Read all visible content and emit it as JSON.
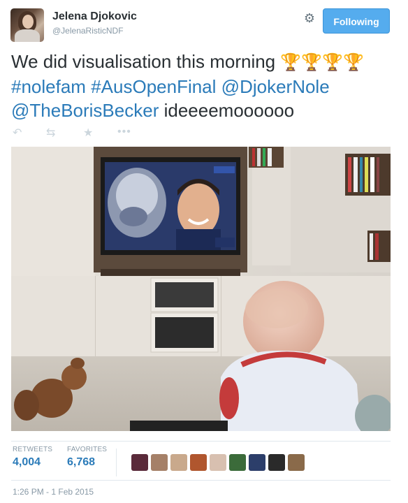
{
  "user": {
    "name": "Jelena Djokovic",
    "handle": "@JelenaRisticNDF",
    "follow_label": "Following"
  },
  "tweet": {
    "text_lead": "We did visualisation this morning",
    "trophy_glyph": "🏆",
    "hashtag1": "#nolefam",
    "hashtag2": "#AusOpenFinal",
    "mention1": "@DjokerNole",
    "mention2": "@TheBorisBecker",
    "text_tail": "ideeeemoooooo"
  },
  "actions": {
    "reply_icon": "reply-icon",
    "retweet_icon": "retweet-icon",
    "favorite_icon": "star-icon",
    "more_icon": "more-icon"
  },
  "stats": {
    "retweets_label": "RETWEETS",
    "retweets_value": "4,004",
    "favorites_label": "FAVORITES",
    "favorites_value": "6,768"
  },
  "timestamp": "1:26 PM - 1 Feb 2015",
  "colors": {
    "link": "#2b7bb9",
    "follow_button": "#55acee",
    "text": "#292f33",
    "muted": "#8899a6"
  }
}
